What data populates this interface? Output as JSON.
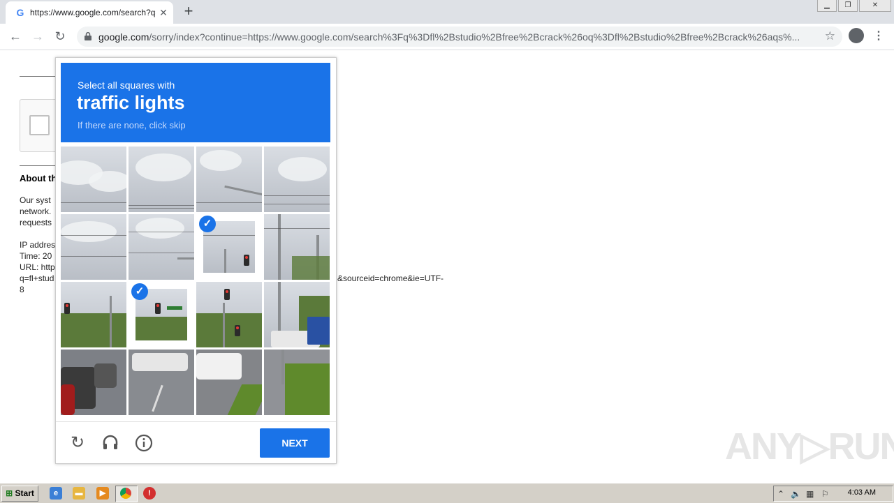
{
  "browser": {
    "tab_title": "https://www.google.com/search?q=",
    "tab_favicon": "G",
    "tab_close": "✕",
    "new_tab": "+",
    "url_domain": "google.com",
    "url_rest": "/sorry/index?continue=https://www.google.com/search%3Fq%3Dfl%2Bstudio%2Bfree%2Bcrack%26oq%3Dfl%2Bstudio%2Bfree%2Bcrack%26aqs%..."
  },
  "page": {
    "about_heading": "About th",
    "para1": [
      "Our syst",
      "network.",
      "requests"
    ],
    "para2": [
      "IP addres",
      "Time: 20",
      "URL: http",
      "q=fl+stud",
      "8"
    ],
    "url_tail": "&sourceid=chrome&ie=UTF-"
  },
  "captcha": {
    "instruction": "Select all squares with",
    "target": "traffic lights",
    "hint": "If there are none, click skip",
    "next_label": "NEXT",
    "selected_tiles": [
      6,
      9
    ],
    "check_mark": "✓"
  },
  "watermark": "ANY▷RUN",
  "taskbar": {
    "start_label": "Start",
    "clock": "4:03 AM"
  },
  "colors": {
    "accent": "#1a73e8"
  }
}
